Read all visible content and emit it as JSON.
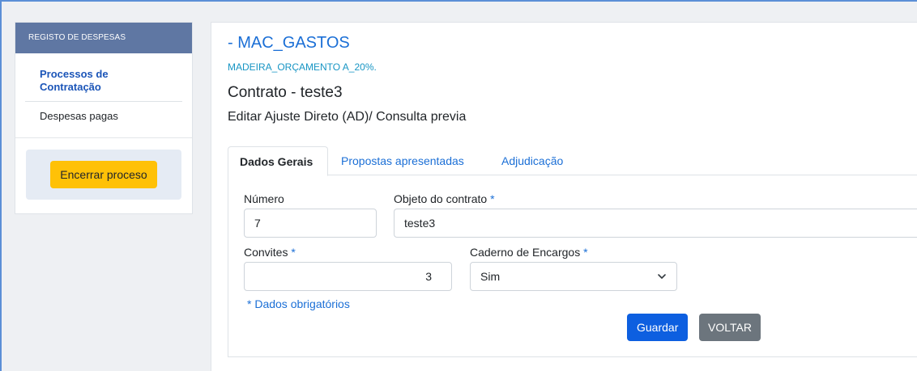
{
  "sidebar": {
    "header": "REGISTO DE DESPESAS",
    "items": [
      {
        "label": "Processos de Contratação"
      },
      {
        "label": "Despesas pagas"
      }
    ],
    "action_label": "Encerrar proceso"
  },
  "header": {
    "title": "- MAC_GASTOS",
    "subtitle": "MADEIRA_ORÇAMENTO A_20%.",
    "contract": "Contrato - teste3",
    "edit": "Editar Ajuste Direto (AD)/ Consulta previa"
  },
  "tabs": [
    {
      "label": "Dados Gerais"
    },
    {
      "label": "Propostas apresentadas"
    },
    {
      "label": "Adjudicação"
    }
  ],
  "form": {
    "numero": {
      "label": "Número",
      "value": "7"
    },
    "objeto": {
      "label": "Objeto do contrato",
      "value": "teste3"
    },
    "convites": {
      "label": "Convites",
      "value": "3"
    },
    "caderno": {
      "label": "Caderno de Encargos",
      "value": "Sim"
    },
    "required_marker": "*",
    "required_note": "* Dados obrigatórios"
  },
  "buttons": {
    "save": "Guardar",
    "back": "VOLTAR"
  },
  "colors": {
    "accent": "#1b6fd6",
    "sidebar_header": "#5f77a3",
    "warning": "#ffc107",
    "primary": "#0d5fe0",
    "secondary": "#6c757d"
  },
  "icons": {
    "select_caret": "chevron-down-icon"
  }
}
